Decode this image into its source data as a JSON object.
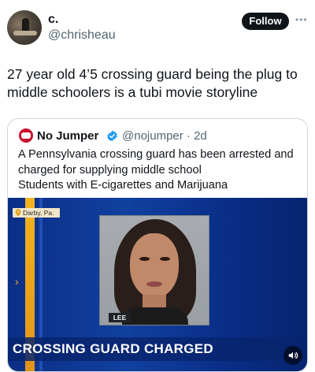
{
  "author": {
    "display_name": "c.",
    "handle": "@chrisheau",
    "follow_label": "Follow",
    "more_icon": "more-horizontal-icon"
  },
  "tweet": {
    "text": "27 year old 4’5 crossing guard being the plug to middle schoolers is a tubi movie storyline"
  },
  "quoted_tweet": {
    "display_name": "No Jumper",
    "verified_icon": "verified-badge-icon",
    "handle_time": "@nojumper · 2d",
    "text_line1": "A Pennsylvania crossing guard has been arrested and",
    "text_line2": "charged for supplying middle school",
    "text_line3": "Students with E-cigarettes and Marijuana",
    "media": {
      "location": "Darby, Pa.",
      "name_tag": "LEE",
      "headline": "CROSSING GUARD CHARGED",
      "sound_icon": "volume-icon"
    }
  },
  "colors": {
    "text": "#0f1419",
    "secondary_text": "#536471",
    "verified": "#1d9bf0",
    "news_blue": "#0b2f86",
    "news_gold": "#f3b420"
  }
}
